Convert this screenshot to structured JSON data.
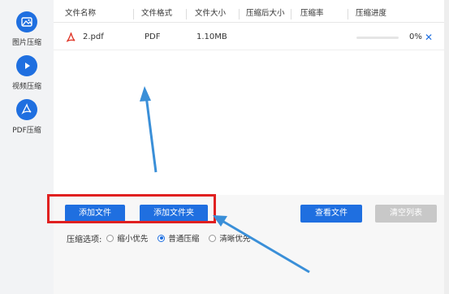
{
  "sidebar": {
    "items": [
      {
        "label": "图片压缩",
        "icon": "image-icon"
      },
      {
        "label": "视频压缩",
        "icon": "video-play-icon"
      },
      {
        "label": "PDF压缩",
        "icon": "pdf-icon"
      }
    ]
  },
  "table": {
    "headers": [
      "文件名称",
      "文件格式",
      "文件大小",
      "压缩后大小",
      "压缩率",
      "压缩进度"
    ],
    "rows": [
      {
        "name": "2.pdf",
        "format": "PDF",
        "size": "1.10MB",
        "compressed_size": "",
        "ratio": "",
        "progress": 0,
        "progress_label": "0%"
      }
    ]
  },
  "buttons": {
    "add_file": "添加文件",
    "add_folder": "添加文件夹",
    "view_files": "查看文件",
    "clear_list": "清空列表"
  },
  "options": {
    "label": "压缩选项:",
    "choices": [
      "缩小优先",
      "普通压缩",
      "清晰优先"
    ],
    "selected": "普通压缩"
  },
  "colors": {
    "accent": "#1f6fe0",
    "highlight": "#e02020",
    "annotation_arrow": "#3a8fd8"
  }
}
